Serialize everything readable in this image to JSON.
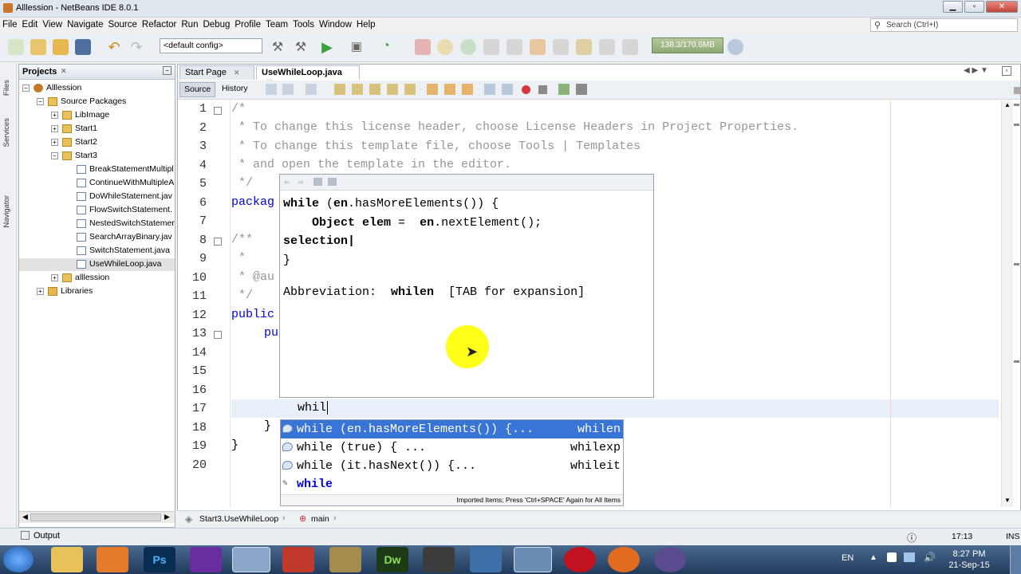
{
  "window": {
    "title": "Alllession - NetBeans IDE 8.0.1",
    "min_label": "▁",
    "max_label": "▫",
    "close_label": "✕"
  },
  "menu": [
    "File",
    "Edit",
    "View",
    "Navigate",
    "Source",
    "Refactor",
    "Run",
    "Debug",
    "Profile",
    "Team",
    "Tools",
    "Window",
    "Help"
  ],
  "search": {
    "placeholder": "Search (Ctrl+I)"
  },
  "toolbar": {
    "config": "<default config>",
    "memory": "138.3/170.6MB"
  },
  "side_tabs": {
    "files": "Files",
    "services": "Services",
    "navigator": "Navigator"
  },
  "projects": {
    "title": "Projects",
    "tree": [
      {
        "label": "Alllession",
        "level": 0,
        "exp": "−",
        "kind": "project"
      },
      {
        "label": "Source Packages",
        "level": 1,
        "exp": "−",
        "kind": "pkgroot"
      },
      {
        "label": "LibImage",
        "level": 2,
        "exp": "+",
        "kind": "pkg"
      },
      {
        "label": "Start1",
        "level": 2,
        "exp": "+",
        "kind": "pkg"
      },
      {
        "label": "Start2",
        "level": 2,
        "exp": "+",
        "kind": "pkg"
      },
      {
        "label": "Start3",
        "level": 2,
        "exp": "−",
        "kind": "pkg"
      },
      {
        "label": "BreakStatementMultipl",
        "level": 3,
        "exp": "",
        "kind": "file"
      },
      {
        "label": "ContinueWithMultipleA",
        "level": 3,
        "exp": "",
        "kind": "file"
      },
      {
        "label": "DoWhileStatement.jav",
        "level": 3,
        "exp": "",
        "kind": "file"
      },
      {
        "label": "FlowSwitchStatement.",
        "level": 3,
        "exp": "",
        "kind": "file"
      },
      {
        "label": "NestedSwitchStatemer",
        "level": 3,
        "exp": "",
        "kind": "file"
      },
      {
        "label": "SearchArrayBinary.jav",
        "level": 3,
        "exp": "",
        "kind": "file"
      },
      {
        "label": "SwitchStatement.java",
        "level": 3,
        "exp": "",
        "kind": "file"
      },
      {
        "label": "UseWhileLoop.java",
        "level": 3,
        "exp": "",
        "kind": "file",
        "selected": true
      },
      {
        "label": "alllession",
        "level": 2,
        "exp": "+",
        "kind": "pkg"
      },
      {
        "label": "Libraries",
        "level": 1,
        "exp": "+",
        "kind": "lib"
      }
    ]
  },
  "editor": {
    "tabs": [
      "Start Page",
      "UseWhileLoop.java"
    ],
    "source_label": "Source",
    "history_label": "History",
    "line_numbers": [
      "1",
      "2",
      "3",
      "4",
      "5",
      "6",
      "7",
      "8",
      "9",
      "10",
      "11",
      "12",
      "13",
      "14",
      "15",
      "16",
      "17",
      "18",
      "19",
      "20"
    ],
    "code": {
      "l1": "/*",
      "l2": " * To change this license header, choose License Headers in Project Properties.",
      "l3": " * To change this template file, choose Tools | Templates",
      "l4": " * and open the template in the editor.",
      "l5": " */",
      "l6": "packag",
      "l8": "/**",
      "l9": " *",
      "l10": " * @au",
      "l11": " */",
      "l12": "public",
      "l13": "pu",
      "l17": "whil",
      "l18": "}",
      "l19": "}"
    }
  },
  "doc_popup": {
    "line1_kw": "while",
    "line1_a": " (",
    "line1_b": "en",
    "line1_c": ".hasMoreElements()) {",
    "line2_a": "Object elem",
    "line2_b": " =  ",
    "line2_c": "en",
    "line2_d": ".nextElement();",
    "line3": "selection|",
    "line4": "}",
    "abbr_label": "Abbreviation:  ",
    "abbr_value": "whilen",
    "abbr_hint": "  [TAB for expansion]"
  },
  "completion": {
    "items": [
      {
        "text": "while (en.hasMoreElements()) {...",
        "abbr": "whilen"
      },
      {
        "text": "while (true) { ...",
        "abbr": "whilexp"
      },
      {
        "text": "while (it.hasNext()) {...",
        "abbr": "whileit"
      },
      {
        "text": "while",
        "abbr": ""
      }
    ],
    "hint": "Imported Items; Press 'Ctrl+SPACE' Again for All Items"
  },
  "breadcrumb": {
    "class": "Start3.UseWhileLoop",
    "method": "main"
  },
  "status": {
    "output": "Output",
    "position": "17:13",
    "mode": "INS"
  },
  "taskbar": {
    "lang": "EN",
    "time": "8:27 PM",
    "date": "21-Sep-15",
    "ps": "Ps",
    "dw": "Dw"
  }
}
